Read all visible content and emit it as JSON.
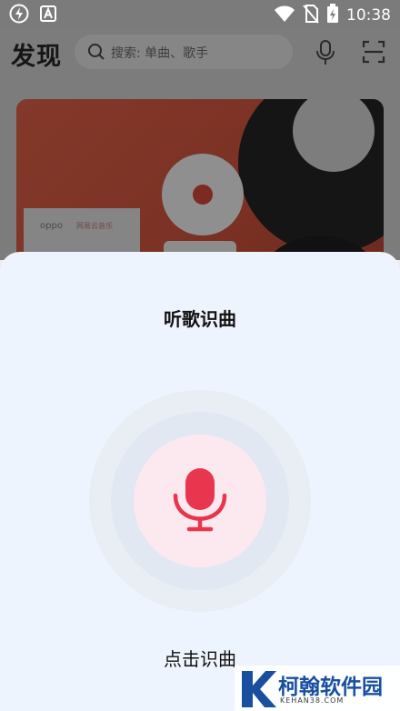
{
  "status_bar": {
    "time": "10:38",
    "icons": [
      "power-saving-icon",
      "a-notification-icon",
      "wifi-icon",
      "no-sim-icon",
      "battery-charging-icon"
    ]
  },
  "header": {
    "title": "发现",
    "search_placeholder": "搜索: 单曲、歌手",
    "icons": [
      "search-icon",
      "microphone-icon",
      "scan-icon"
    ]
  },
  "banner": {
    "brand_text": "oppo",
    "partner_text": "网易云音乐"
  },
  "sheet": {
    "title": "听歌识曲",
    "tap_label": "点击识曲",
    "accent_color": "#e8364f"
  },
  "watermark": {
    "text": "柯翰软件园",
    "sub": "KEHAN38.COM"
  }
}
